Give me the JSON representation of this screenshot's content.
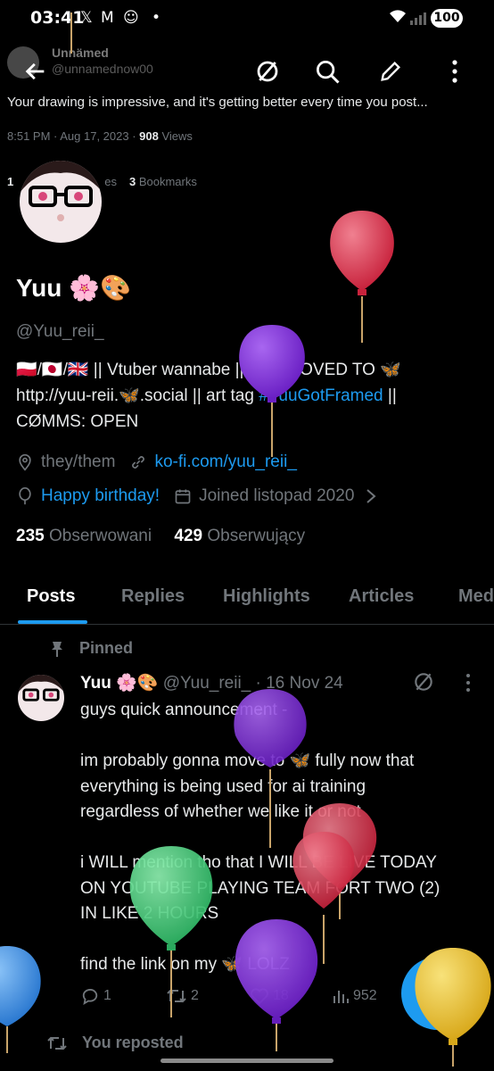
{
  "status": {
    "time": "03:41",
    "battery": "100",
    "icons": [
      "x-logo-icon",
      "gmail-icon",
      "discord-icon",
      "dot-icon",
      "wifi-icon",
      "signal-icon"
    ]
  },
  "ghost": {
    "name": "Unnämed",
    "handle": "@unnamednow00",
    "text": "Your drawing is impressive, and it's getting better every time you post...",
    "time": "8:51 PM · Aug 17, 2023 · ",
    "views": "908",
    "views_label": " Views",
    "stat1": "1",
    "stat1_label": "es",
    "bookmarks": "3",
    "bookmarks_label": " Bookmarks"
  },
  "profile": {
    "name": "Yuu 🌸🎨",
    "handle": "@Yuu_reii_",
    "bio_line1": "🇵🇱/🇯🇵/🇬🇧 || Vtuber wannabe || ART MOVED TO 🦋",
    "bio_line2_a": "http://yuu-reii.🦋.social || art tag ",
    "bio_hashtag": "#YuuGotFramed",
    "bio_line2_b": " ||",
    "bio_line3": "CØMMS: OPEN",
    "pronouns": "they/them",
    "website": "ko-fi.com/yuu_reii_",
    "birthday": "Happy birthday!",
    "joined": "Joined listopad 2020",
    "following_count": "235",
    "following_label": " Obserwowani",
    "followers_count": "429",
    "followers_label": " Obserwujący"
  },
  "tabs": [
    "Posts",
    "Replies",
    "Highlights",
    "Articles",
    "Med"
  ],
  "tweet": {
    "pinned_label": "Pinned",
    "name": "Yuu 🌸🎨",
    "handle_time": " @Yuu_reii_ · 16 Nov 24",
    "lines": [
      "guys quick announcement -",
      "",
      "im probably gonna move to 🦋 fully now that",
      "everything is being used for ai training",
      "regardless of whether we like it or not",
      "",
      "i WILL mention tho that I WILL BE LIVE TODAY",
      "ON YOUTUBE PLAYING TEAM FORT TWO (2)",
      "IN LIKE 2 HOURS",
      "",
      "find the link on my 🦋 LOLZ"
    ],
    "replies": "1",
    "reposts": "2",
    "likes": "18",
    "views": "952",
    "reposted_label": "You reposted"
  },
  "colors": {
    "accent": "#1d9bf0",
    "balloon_red": "#d83a52",
    "balloon_purple": "#7b2fd6",
    "balloon_green": "#3fcf7a",
    "balloon_yellow": "#e8c22e",
    "balloon_blue": "#3b8fe0"
  }
}
